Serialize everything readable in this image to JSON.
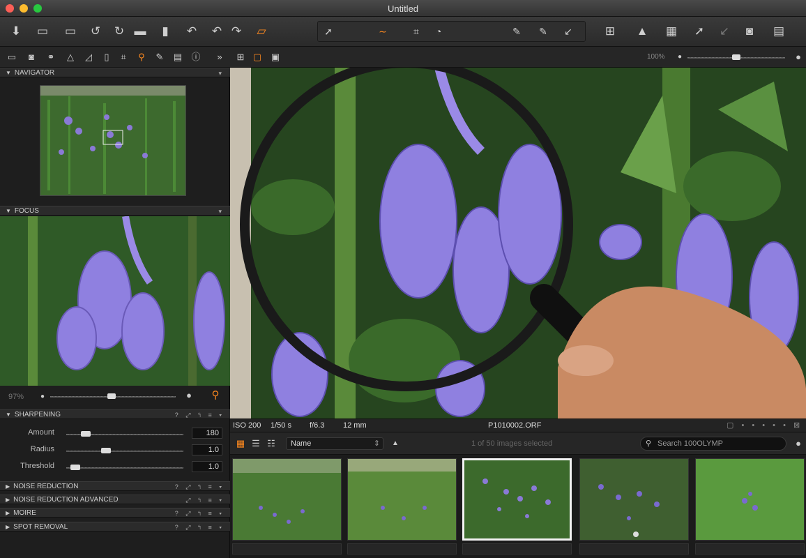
{
  "window": {
    "title": "Untitled"
  },
  "navigator": {
    "title": "NAVIGATOR"
  },
  "focus": {
    "title": "FOCUS",
    "zoom": "97%"
  },
  "viewer": {
    "zoom": "100%"
  },
  "sharpening": {
    "title": "SHARPENING",
    "amount_label": "Amount",
    "amount_value": "180",
    "radius_label": "Radius",
    "radius_value": "1.0",
    "threshold_label": "Threshold",
    "threshold_value": "1.0"
  },
  "sections": [
    {
      "label": "NOISE REDUCTION"
    },
    {
      "label": "NOISE REDUCTION ADVANCED"
    },
    {
      "label": "MOIRE"
    },
    {
      "label": "SPOT REMOVAL"
    }
  ],
  "info": {
    "iso": "ISO 200",
    "shutter": "1/50 s",
    "aperture": "f/6.3",
    "focal": "12 mm",
    "filename": "P1010002.ORF"
  },
  "browser": {
    "sort": "Name",
    "selection": "1 of 50 images selected",
    "search_placeholder": "Search 100OLYMP"
  },
  "colors": {
    "accent": "#ff8a1f",
    "bg": "#1c1c1c"
  },
  "icons": [
    "import-icon",
    "capture-icon",
    "camera-icon",
    "rotate-left-icon",
    "rotate-right-icon",
    "folder-icon",
    "trash-icon",
    "undo-icon",
    "redo-icon",
    "layers-icon",
    "grid-icon",
    "warning-icon",
    "crop-icon",
    "export-icon",
    "print-icon",
    "search-icon",
    "loupe-icon"
  ]
}
